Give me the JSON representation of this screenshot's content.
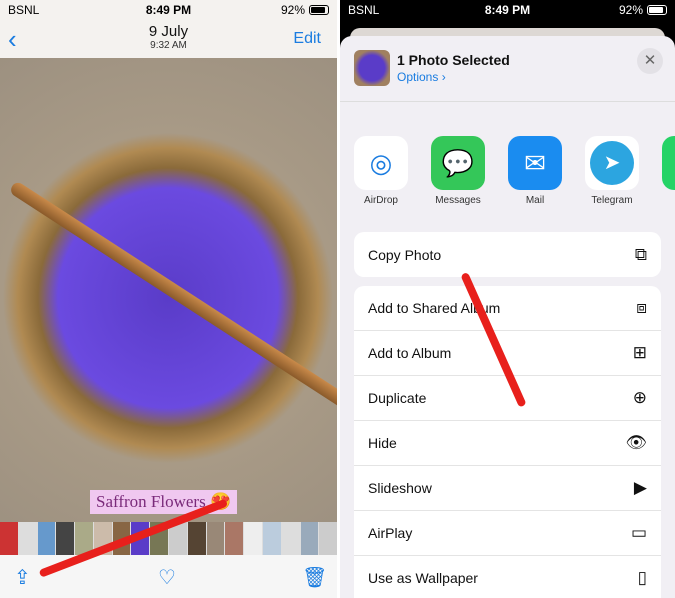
{
  "status": {
    "carrier": "BSNL",
    "time": "8:49 PM",
    "battery": "92%"
  },
  "photos": {
    "date": "9 July",
    "time": "9:32 AM",
    "edit": "Edit",
    "caption": "Saffron Flowers 😍",
    "back_icon": "chevron-left-icon",
    "toolbar": [
      "share-icon",
      "heart-icon",
      "trash-icon"
    ]
  },
  "share": {
    "title": "1 Photo Selected",
    "options": "Options ›",
    "apps": [
      {
        "label": "AirDrop",
        "color": "#ffffff"
      },
      {
        "label": "Messages",
        "color": "#34c759"
      },
      {
        "label": "Mail",
        "color": "#1a8cf0"
      },
      {
        "label": "Telegram",
        "color": "#2ca5e0"
      },
      {
        "label": "Wh",
        "color": "#25d366"
      }
    ],
    "actions": [
      {
        "label": "Copy Photo",
        "icon": "copy-icon"
      },
      {
        "label": "Add to Shared Album",
        "icon": "shared-album-icon"
      },
      {
        "label": "Add to Album",
        "icon": "add-album-icon"
      },
      {
        "label": "Duplicate",
        "icon": "duplicate-icon"
      },
      {
        "label": "Hide",
        "icon": "eye-slash-icon"
      },
      {
        "label": "Slideshow",
        "icon": "play-icon"
      },
      {
        "label": "AirPlay",
        "icon": "airplay-icon"
      },
      {
        "label": "Use as Wallpaper",
        "icon": "phone-icon"
      }
    ]
  },
  "accent": "#1a7ce0",
  "arrow_color": "#e8201c"
}
